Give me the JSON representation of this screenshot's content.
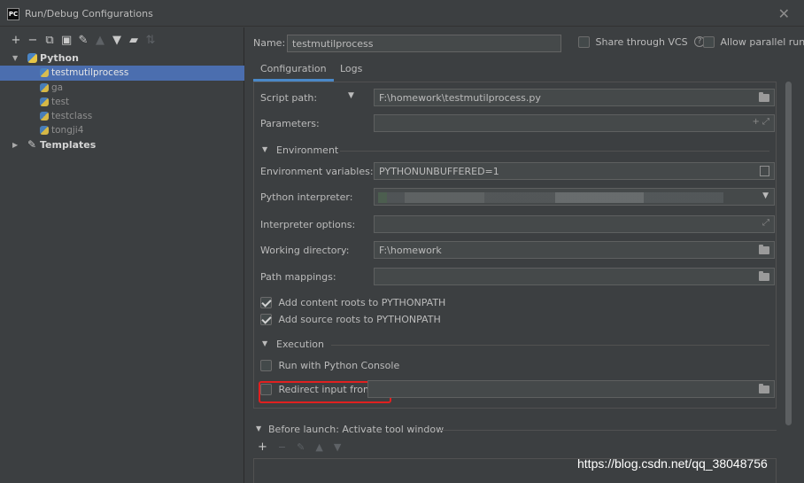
{
  "window": {
    "title": "Run/Debug Configurations",
    "app_icon_text": "PC"
  },
  "left_toolbar": {
    "buttons": [
      {
        "icon": "add",
        "glyph": "+"
      },
      {
        "icon": "remove",
        "glyph": "−"
      },
      {
        "icon": "copy",
        "glyph": "⧉"
      },
      {
        "icon": "save",
        "glyph": "▣"
      },
      {
        "icon": "wrench",
        "glyph": "✎"
      },
      {
        "icon": "move-up",
        "glyph": "▲"
      },
      {
        "icon": "move-down",
        "glyph": "▼"
      },
      {
        "icon": "folder",
        "glyph": "▰"
      },
      {
        "icon": "sort",
        "glyph": "⇅"
      }
    ]
  },
  "tree": {
    "python_label": "Python",
    "items": [
      "testmutilprocess",
      "ga",
      "test",
      "testclass",
      "tongji4"
    ],
    "templates_label": "Templates"
  },
  "name": {
    "label": "Name:",
    "value": "testmutilprocess"
  },
  "share_label": "Share through VCS",
  "parallel_label": "Allow parallel run",
  "tabs": [
    "Configuration",
    "Logs"
  ],
  "form": {
    "script_path_label": "Script path:",
    "script_path_value": "F:\\homework\\testmutilprocess.py",
    "parameters_label": "Parameters:",
    "environment_section": "Environment",
    "env_vars_label": "Environment variables:",
    "env_vars_value": "PYTHONUNBUFFERED=1",
    "interpreter_label": "Python interpreter:",
    "interpreter_options_label": "Interpreter options:",
    "working_dir_label": "Working directory:",
    "working_dir_value": "F:\\homework",
    "path_mappings_label": "Path mappings:",
    "add_content_roots": "Add content roots to PYTHONPATH",
    "add_source_roots": "Add source roots to PYTHONPATH",
    "execution_section": "Execution",
    "run_with_console": "Run with Python Console",
    "redirect_input": "Redirect input from:"
  },
  "before_launch": {
    "label": "Before launch: Activate tool window"
  },
  "watermark": "https://blog.csdn.net/qq_38048756"
}
